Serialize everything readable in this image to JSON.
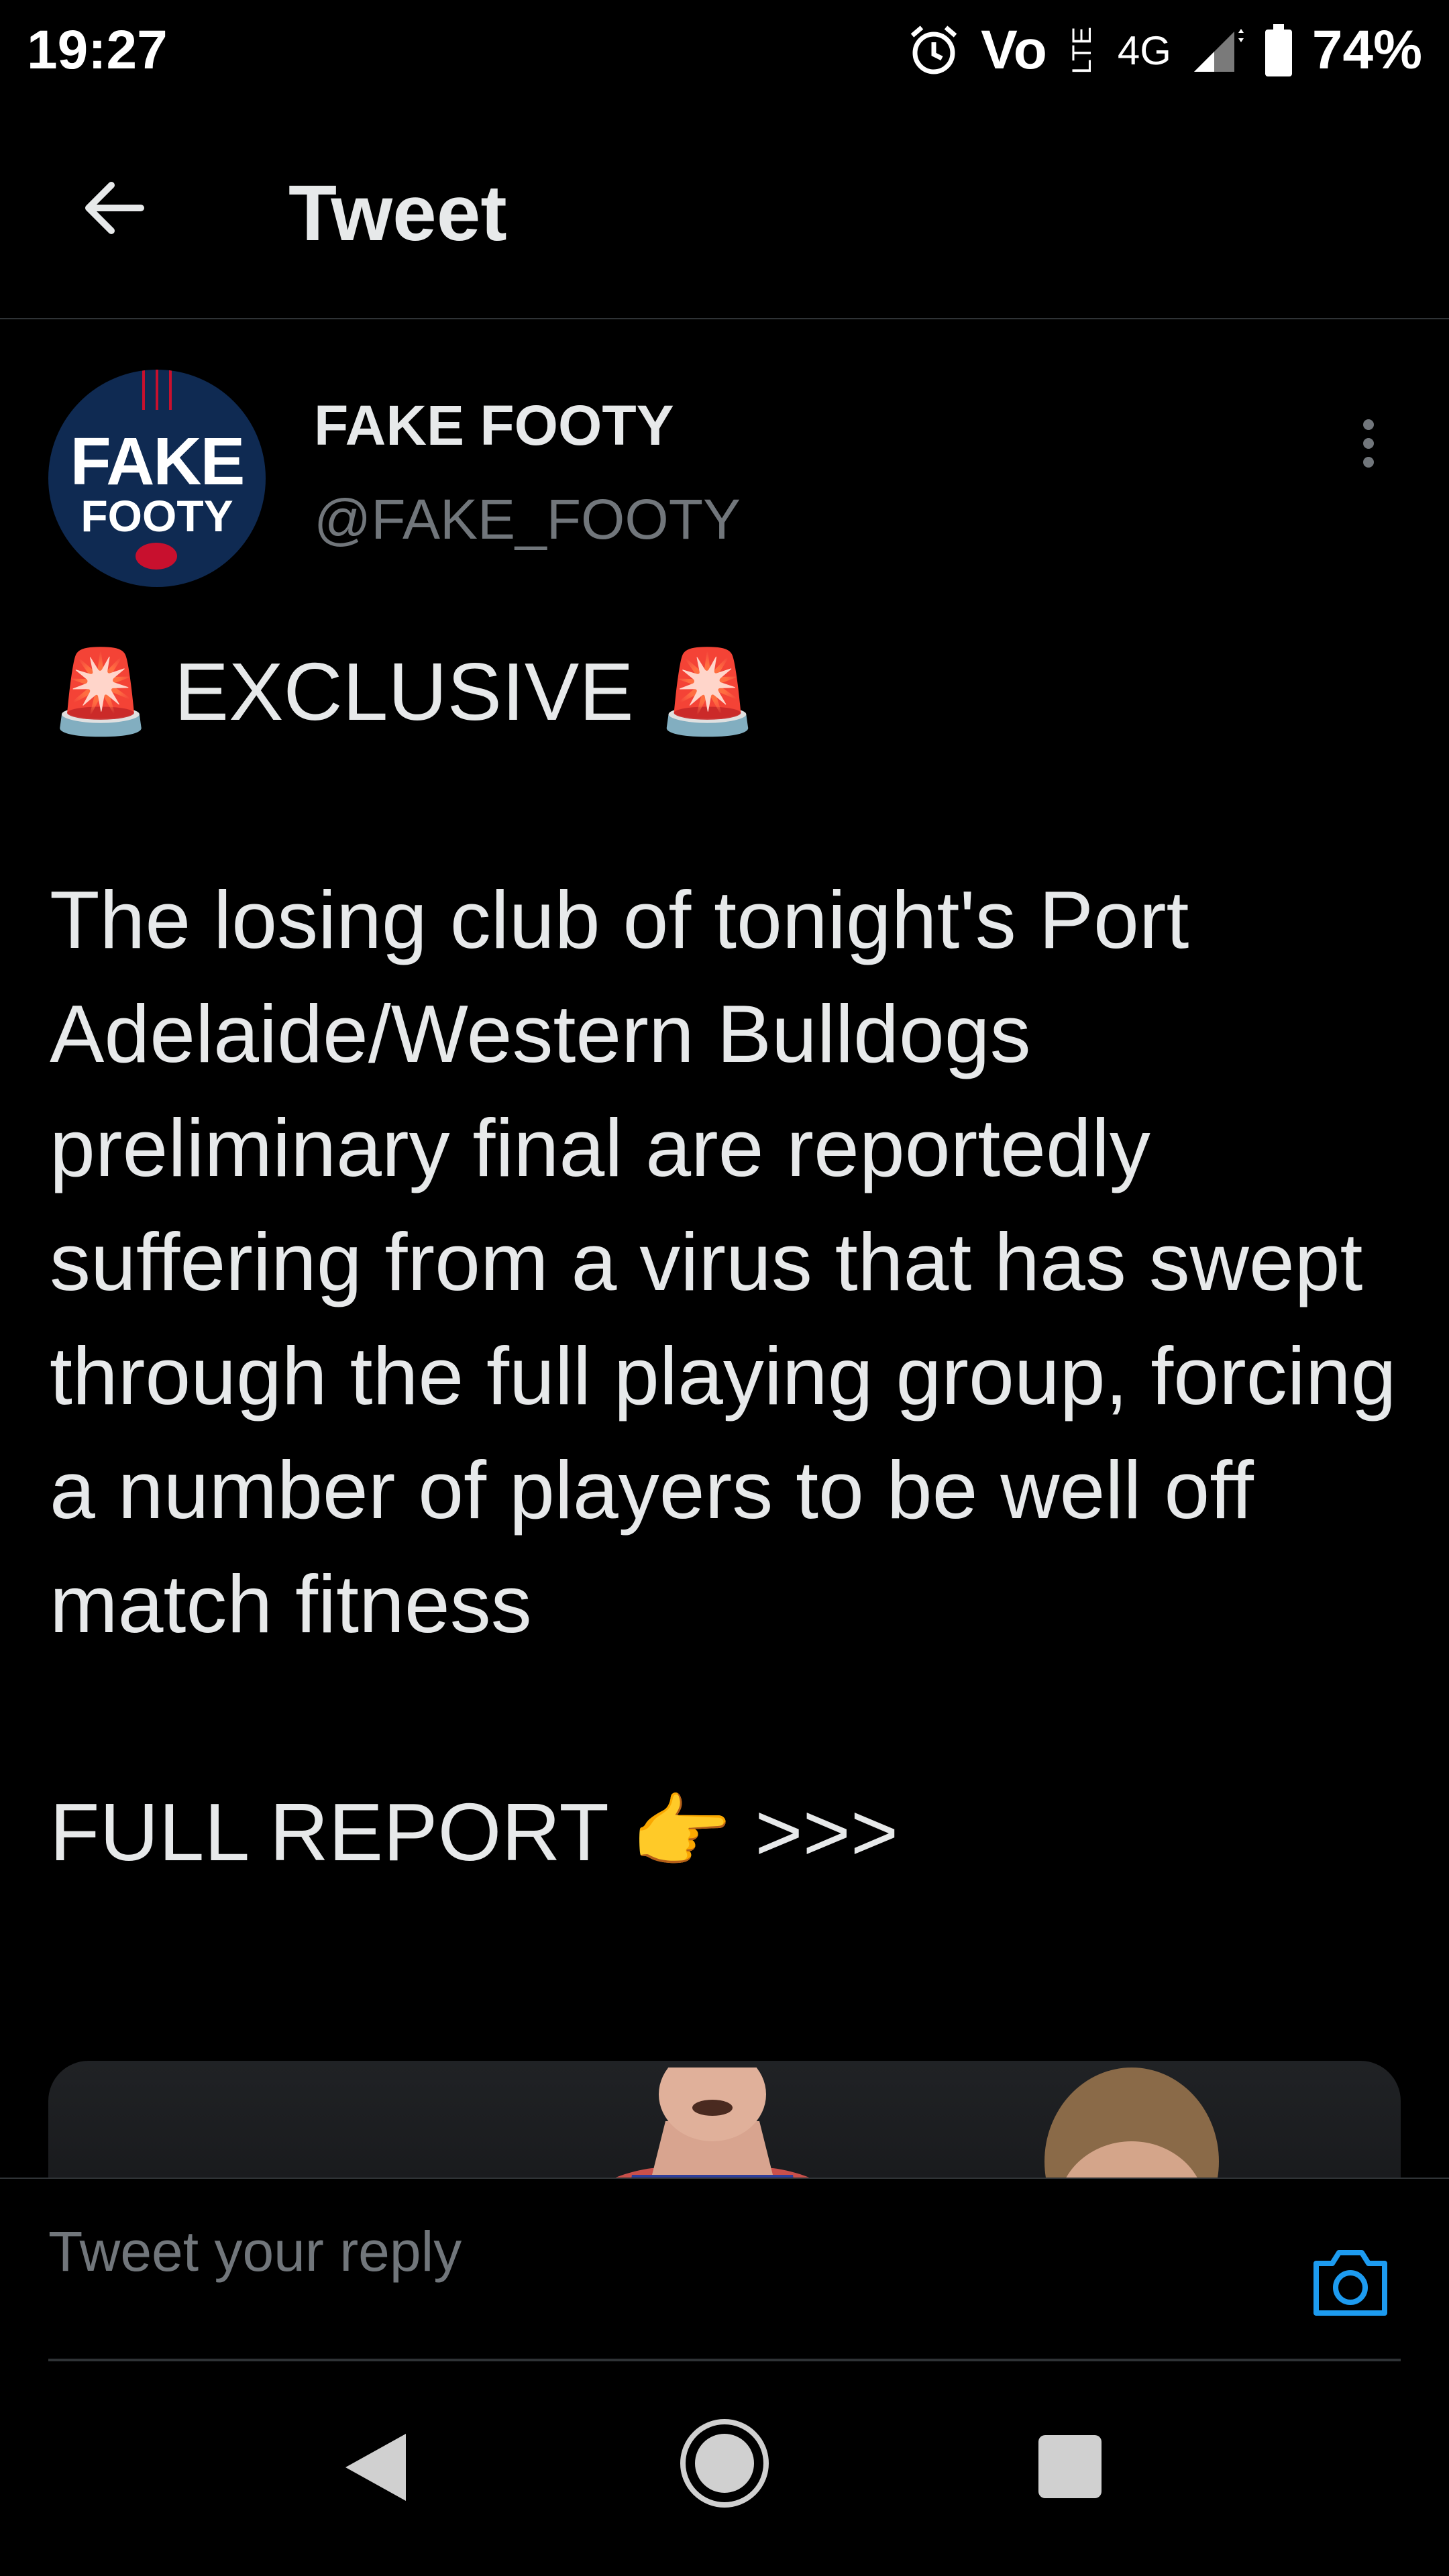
{
  "status_bar": {
    "time": "19:27",
    "carrier": "Vo",
    "lte": "LTE",
    "network": "4G",
    "battery": "74%",
    "icons": [
      "alarm-icon",
      "volte-icon",
      "signal-icon",
      "battery-icon"
    ]
  },
  "header": {
    "title": "Tweet",
    "back_icon": "back-arrow-icon"
  },
  "tweet": {
    "avatar": {
      "line1": "FAKE",
      "line2": "FOOTY"
    },
    "author_name": "FAKE FOOTY",
    "author_handle": "@FAKE_FOOTY",
    "text": "🚨 EXCLUSIVE 🚨\n\nThe losing club of tonight's Port Adelaide/Western Bulldogs preliminary final are reportedly suffering from a virus that has swept through the full playing group, forcing a number of players to be well off match fitness\n\nFULL REPORT 👉 >>>"
  },
  "reply": {
    "placeholder": "Tweet your reply",
    "camera_icon": "camera-icon"
  },
  "nav": {
    "icons": [
      "nav-back-icon",
      "nav-home-icon",
      "nav-recents-icon"
    ]
  },
  "colors": {
    "background": "#000000",
    "text": "#e7e9ea",
    "muted": "#71767b",
    "accent": "#1d9bf0",
    "divider": "#2f3336"
  }
}
